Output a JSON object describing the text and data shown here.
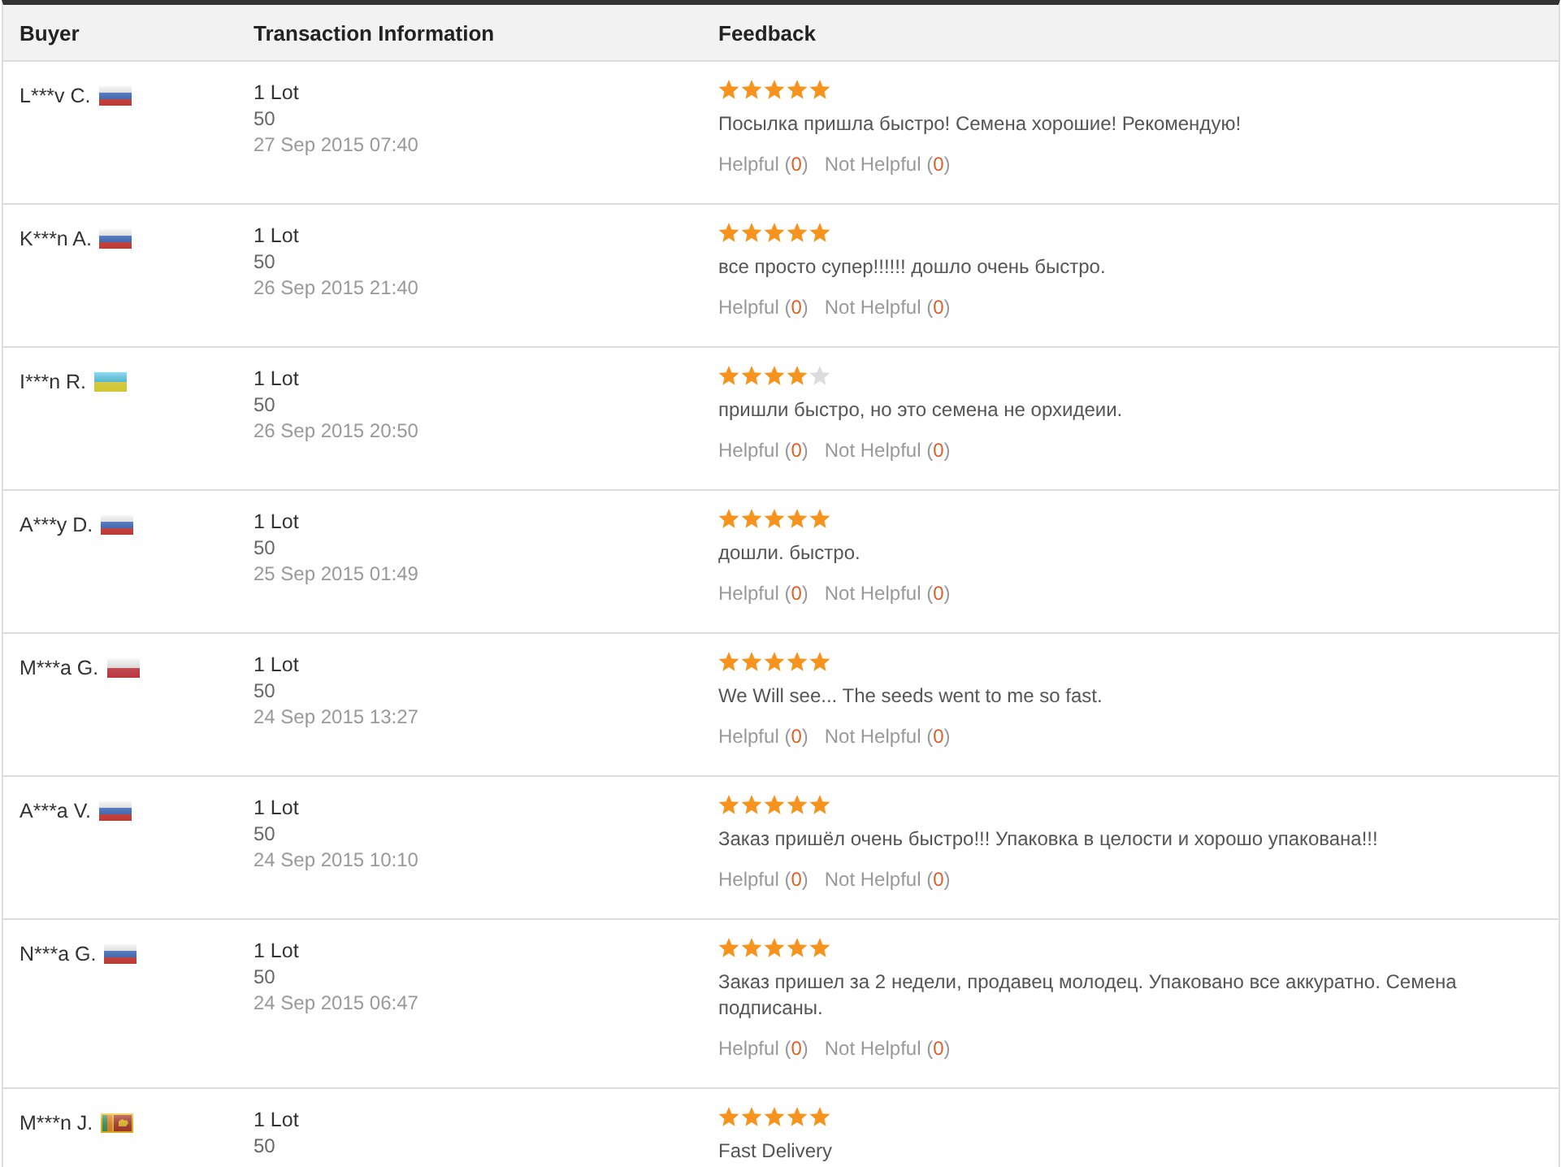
{
  "table": {
    "columns": [
      "Buyer",
      "Transaction Information",
      "Feedback"
    ],
    "rows": [
      {
        "buyer": {
          "name": "L***v C.",
          "flag": {
            "kind": "russia"
          }
        },
        "transaction": {
          "quantity": "1 Lot",
          "detail": "50",
          "date": "27 Sep 2015 07:40"
        },
        "feedback": {
          "stars": 5,
          "text": "Посылка пришла быстро! Семена хорошие! Рекомендую!",
          "votes": [
            {
              "label": "Helpful (",
              "count": "0",
              "end": ")"
            },
            {
              "label": "Not Helpful (",
              "count": "0",
              "end": ")"
            }
          ]
        }
      },
      {
        "buyer": {
          "name": "K***n A.",
          "flag": {
            "kind": "russia"
          }
        },
        "transaction": {
          "quantity": "1 Lot",
          "detail": "50",
          "date": "26 Sep 2015 21:40"
        },
        "feedback": {
          "stars": 5,
          "text": "все просто супер!!!!!! дошло очень быстро.",
          "votes": [
            {
              "label": "Helpful (",
              "count": "0",
              "end": ")"
            },
            {
              "label": "Not Helpful (",
              "count": "0",
              "end": ")"
            }
          ]
        }
      },
      {
        "buyer": {
          "name": "I***n R.",
          "flag": {
            "kind": "ukraine"
          }
        },
        "transaction": {
          "quantity": "1 Lot",
          "detail": "50",
          "date": "26 Sep 2015 20:50"
        },
        "feedback": {
          "stars": 4,
          "text": "пришли быстро, но это семена не орхидеии.",
          "votes": [
            {
              "label": "Helpful (",
              "count": "0",
              "end": ")"
            },
            {
              "label": "Not Helpful (",
              "count": "0",
              "end": ")"
            }
          ]
        }
      },
      {
        "buyer": {
          "name": "A***y D.",
          "flag": {
            "kind": "russia"
          }
        },
        "transaction": {
          "quantity": "1 Lot",
          "detail": "50",
          "date": "25 Sep 2015 01:49"
        },
        "feedback": {
          "stars": 5,
          "text": "дошли. быстро.",
          "votes": [
            {
              "label": "Helpful (",
              "count": "0",
              "end": ")"
            },
            {
              "label": "Not Helpful (",
              "count": "0",
              "end": ")"
            }
          ]
        }
      },
      {
        "buyer": {
          "name": "M***a G.",
          "flag": {
            "kind": "poland"
          }
        },
        "transaction": {
          "quantity": "1 Lot",
          "detail": "50",
          "date": "24 Sep 2015 13:27"
        },
        "feedback": {
          "stars": 5,
          "text": "We Will see... The seeds went to me so fast.",
          "votes": [
            {
              "label": "Helpful (",
              "count": "0",
              "end": ")"
            },
            {
              "label": "Not Helpful (",
              "count": "0",
              "end": ")"
            }
          ]
        }
      },
      {
        "buyer": {
          "name": "A***a V.",
          "flag": {
            "kind": "russia"
          }
        },
        "transaction": {
          "quantity": "1 Lot",
          "detail": "50",
          "date": "24 Sep 2015 10:10"
        },
        "feedback": {
          "stars": 5,
          "text": "Заказ пришёл очень быстро!!! Упаковка в целости и хорошо упакована!!!",
          "votes": [
            {
              "label": "Helpful (",
              "count": "0",
              "end": ")"
            },
            {
              "label": "Not Helpful (",
              "count": "0",
              "end": ")"
            }
          ]
        }
      },
      {
        "buyer": {
          "name": "N***a G.",
          "flag": {
            "kind": "russia"
          }
        },
        "transaction": {
          "quantity": "1 Lot",
          "detail": "50",
          "date": "24 Sep 2015 06:47"
        },
        "feedback": {
          "stars": 5,
          "text": "Заказ пришел за 2 недели, продавец молодец. Упаковано все аккуратно. Семена подписаны.",
          "votes": [
            {
              "label": "Helpful (",
              "count": "0",
              "end": ")"
            },
            {
              "label": "Not Helpful (",
              "count": "0",
              "end": ")"
            }
          ]
        }
      },
      {
        "buyer": {
          "name": "M***n J.",
          "flag": {
            "kind": "sri_lanka"
          }
        },
        "transaction": {
          "quantity": "1 Lot",
          "detail": "50"
        },
        "feedback": {
          "stars": 5,
          "text": "Fast Delivery"
        }
      }
    ]
  }
}
